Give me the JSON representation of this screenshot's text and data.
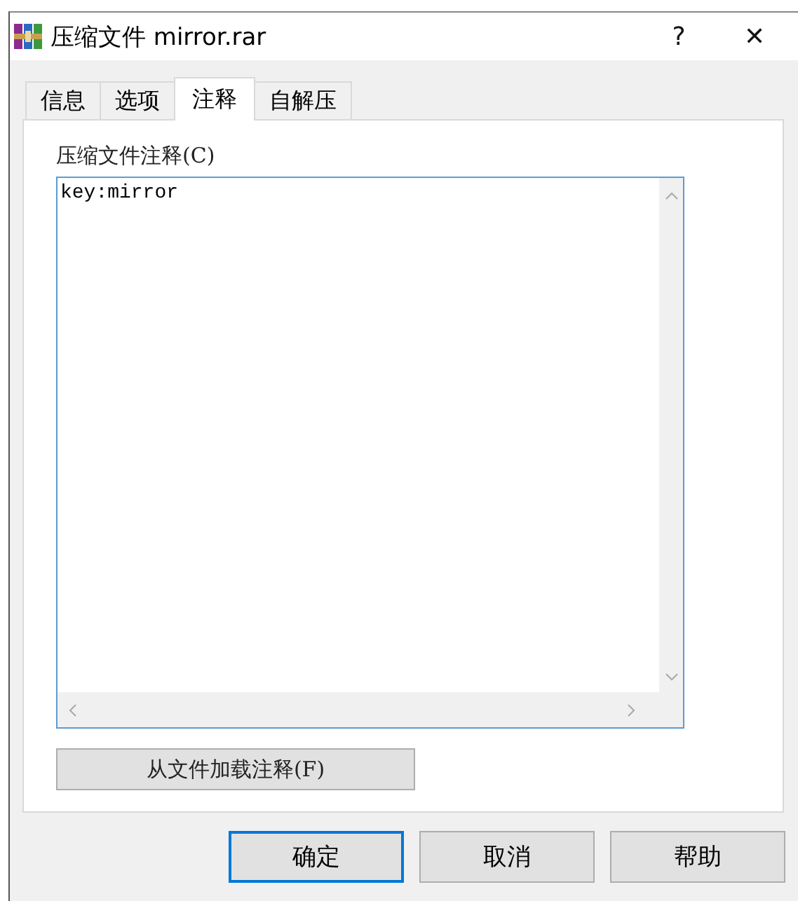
{
  "window": {
    "title": "压缩文件 mirror.rar",
    "help": "?",
    "close": "✕"
  },
  "tabs": [
    {
      "label": "信息",
      "selected": false
    },
    {
      "label": "选项",
      "selected": false
    },
    {
      "label": "注释",
      "selected": true
    },
    {
      "label": "自解压",
      "selected": false
    }
  ],
  "comment": {
    "label": "压缩文件注释(C)",
    "value": "key:mirror"
  },
  "load_button": "从文件加载注释(F)",
  "buttons": [
    {
      "label": "确定",
      "default": true
    },
    {
      "label": "取消",
      "default": false
    },
    {
      "label": "帮助",
      "default": false
    }
  ]
}
